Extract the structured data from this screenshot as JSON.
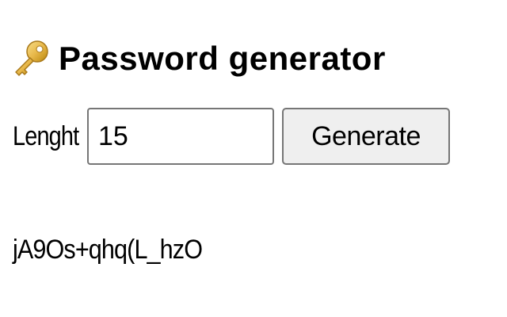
{
  "header": {
    "icon": "key-icon",
    "title": "Password generator"
  },
  "form": {
    "length_label": "Lenght",
    "length_value": "15",
    "generate_label": "Generate"
  },
  "output": {
    "password": "jA9Os+qhq(L_hzO"
  },
  "colors": {
    "key_gold": "#e8b84a",
    "key_dark": "#b8860b",
    "border": "#767676",
    "button_bg": "#efefef"
  }
}
